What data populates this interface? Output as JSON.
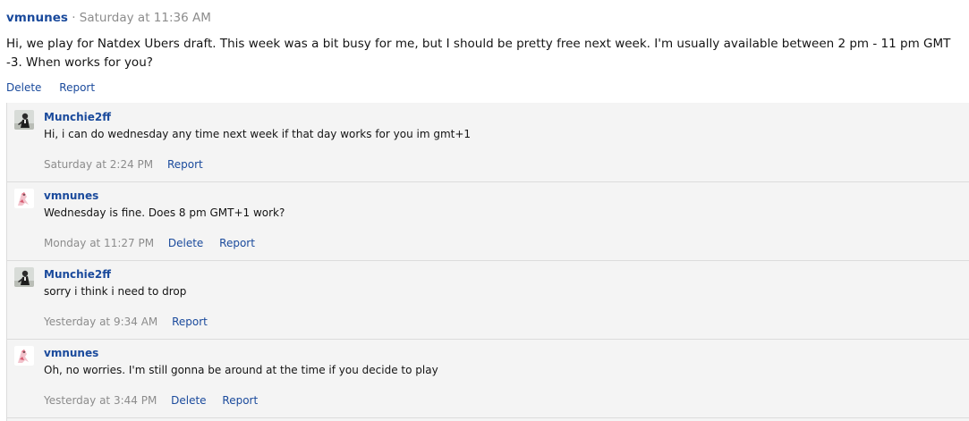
{
  "post": {
    "author": "vmnunes",
    "separator": "·",
    "timestamp": "Saturday at 11:36 AM",
    "text": "Hi, we play for Natdex Ubers draft. This week was a bit busy for me, but I should be pretty free next week. I'm usually available between 2 pm - 11 pm GMT -3. When works for you?",
    "actions": {
      "delete": "Delete",
      "report": "Report"
    }
  },
  "comments": [
    {
      "author": "Munchie2ff",
      "avatar_icon": "dark-figure-avatar-icon",
      "text": "Hi, i can do wednesday any time next week if that day works for you im gmt+1",
      "timestamp": "Saturday at 2:24 PM",
      "report": "Report"
    },
    {
      "author": "vmnunes",
      "avatar_icon": "pink-character-avatar-icon",
      "text": "Wednesday is fine. Does 8 pm GMT+1 work?",
      "timestamp": "Monday at 11:27 PM",
      "delete": "Delete",
      "report": "Report"
    },
    {
      "author": "Munchie2ff",
      "avatar_icon": "dark-figure-avatar-icon",
      "text": "sorry i think i need to drop",
      "timestamp": "Yesterday at 9:34 AM",
      "report": "Report"
    },
    {
      "author": "vmnunes",
      "avatar_icon": "pink-character-avatar-icon",
      "text": "Oh, no worries. I'm still gonna be around at the time if you decide to play",
      "timestamp": "Yesterday at 3:44 PM",
      "delete": "Delete",
      "report": "Report"
    }
  ],
  "colors": {
    "link": "#1a4a9c",
    "muted": "#8c8c8c",
    "comment_bg": "#f4f4f4",
    "border": "#dcdcdc"
  }
}
